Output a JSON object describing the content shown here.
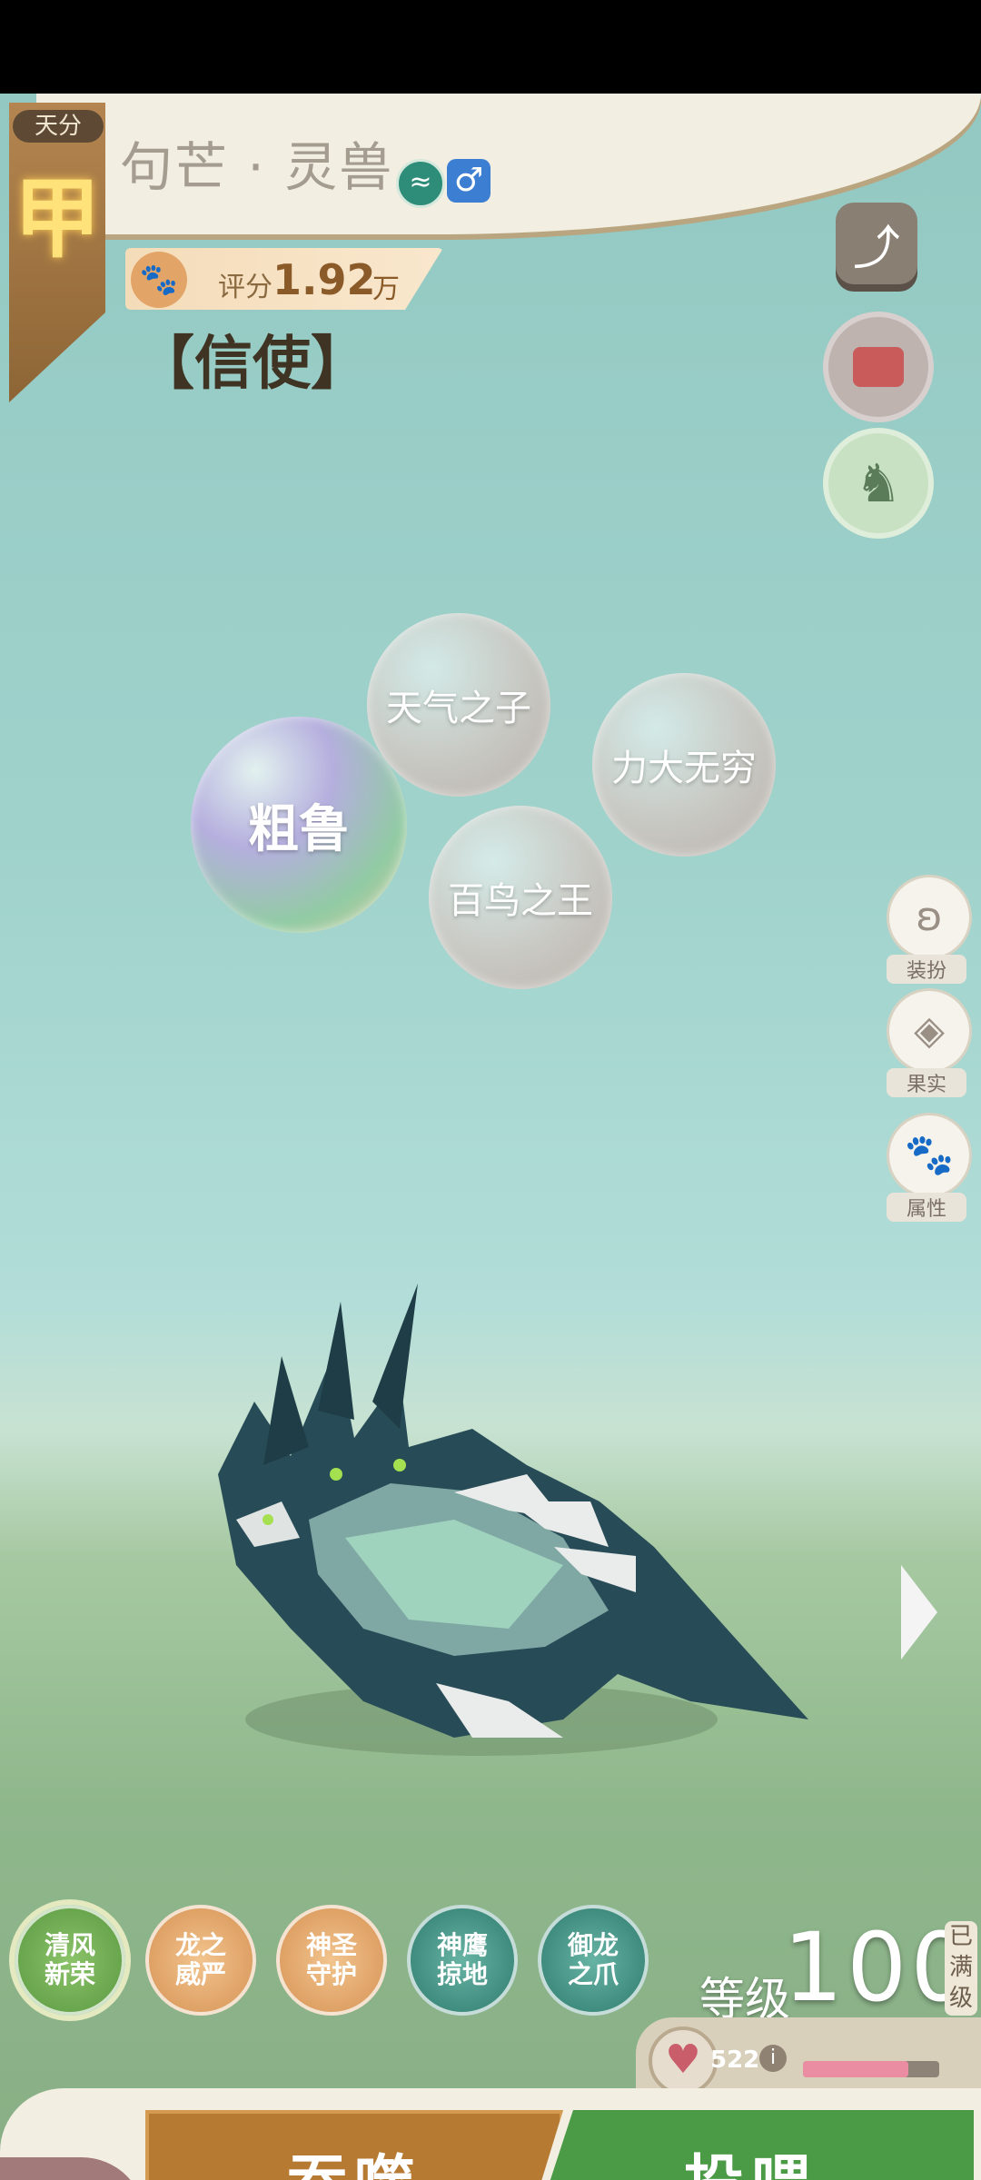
{
  "header": {
    "grade_label": "天分",
    "grade": "甲",
    "title": "句芒 · 灵兽",
    "role": "【信使】"
  },
  "score": {
    "label": "评分",
    "value": "1.92",
    "unit": "万"
  },
  "bubbles": {
    "weather": "天气之子",
    "power": "力大无穷",
    "birds": "百鸟之王",
    "rough": "粗鲁"
  },
  "side_buttons": {
    "dress": "装扮",
    "fruit": "果实",
    "attr": "属性"
  },
  "skills": [
    "清风\n新荣",
    "龙之\n威严",
    "神圣\n守护",
    "神鹰\n掠地",
    "御龙\n之爪"
  ],
  "level": {
    "label": "等级",
    "value": "100",
    "max_tag": "已\n满\n级"
  },
  "hp": {
    "value": "522"
  },
  "actions": {
    "devour": "吞噬",
    "feed": "投喂"
  },
  "colors": {
    "feed_green": "#4b9a45",
    "devour_orange": "#b77a32",
    "hp_pink": "#eb8da2"
  }
}
